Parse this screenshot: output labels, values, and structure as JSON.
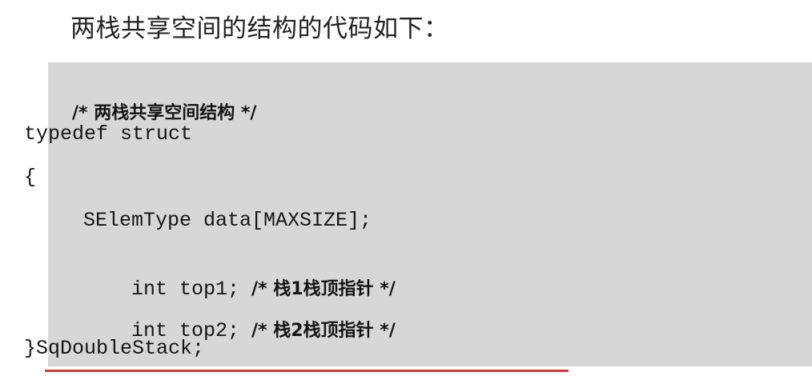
{
  "intro_text": "两栈共享空间的结构的代码如下：",
  "code": {
    "comment_line": "/* 两栈共享空间结构 */",
    "typedef_line": "typedef struct",
    "open_brace": "{",
    "data_line": "SElemType data[MAXSIZE];",
    "top1_code": "int top1; ",
    "top1_comment": "/* 栈1栈顶指针 */",
    "top2_code": "int top2; ",
    "top2_comment": "/* 栈2栈顶指针 */",
    "close_line": "}SqDoubleStack;"
  },
  "colors": {
    "code_background": "#d7d7d7",
    "underline": "#d63a2e"
  }
}
